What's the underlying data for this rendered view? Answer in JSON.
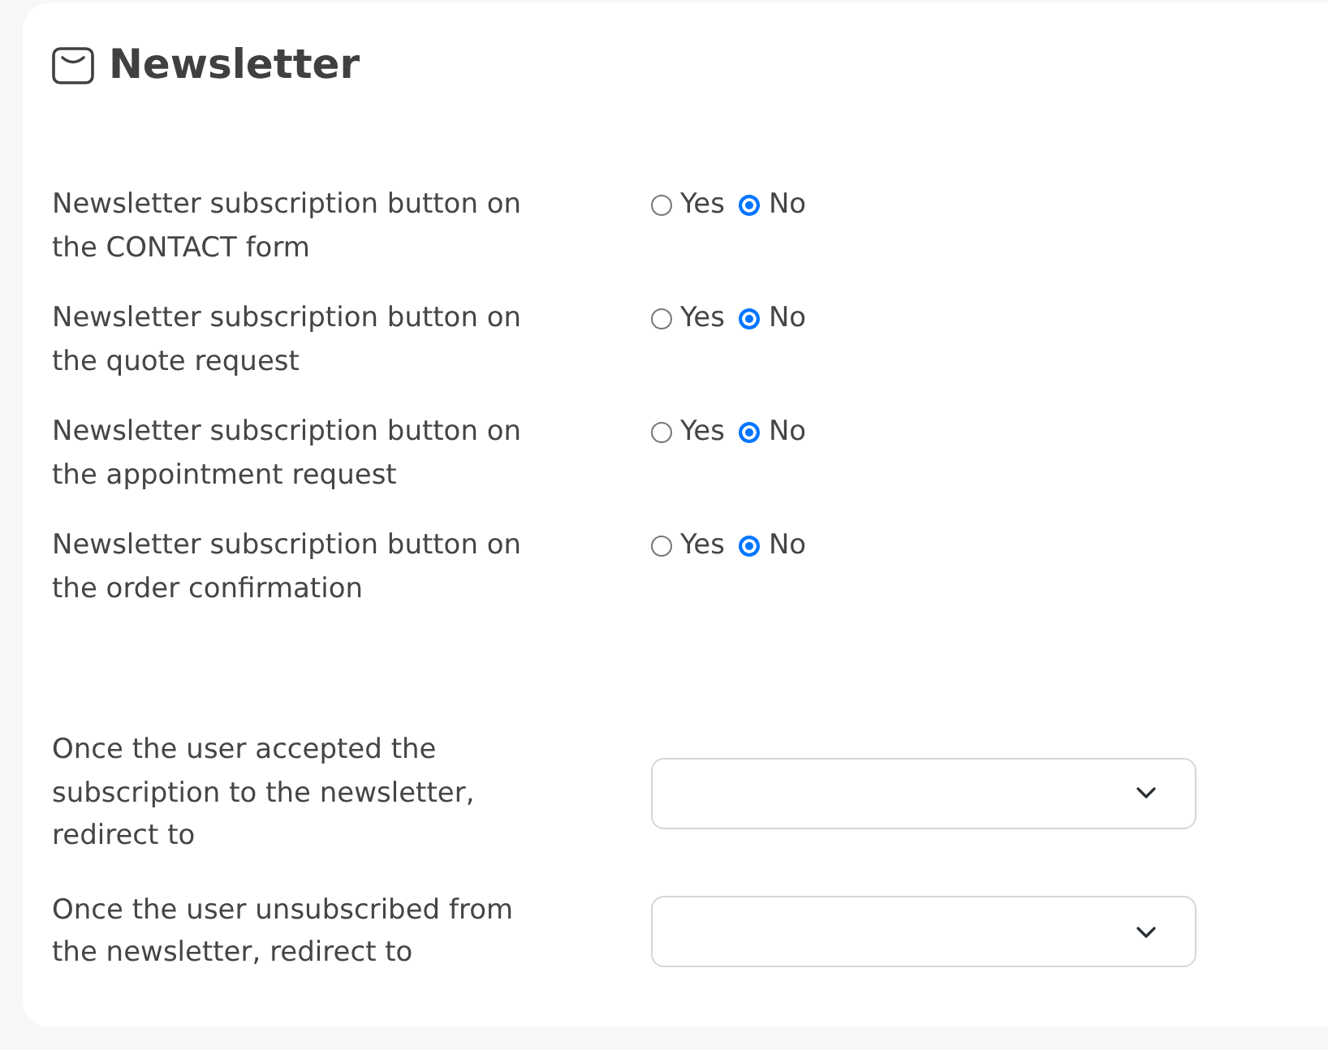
{
  "section": {
    "title": "Newsletter"
  },
  "options": [
    {
      "label": "Newsletter subscription button on the CONTACT form",
      "choices": [
        {
          "label": "Yes",
          "selected": false
        },
        {
          "label": "No",
          "selected": true
        }
      ]
    },
    {
      "label": "Newsletter subscription button on the quote request",
      "choices": [
        {
          "label": "Yes",
          "selected": false
        },
        {
          "label": "No",
          "selected": true
        }
      ]
    },
    {
      "label": "Newsletter subscription button on the appointment request",
      "choices": [
        {
          "label": "Yes",
          "selected": false
        },
        {
          "label": "No",
          "selected": true
        }
      ]
    },
    {
      "label": "Newsletter subscription button on the order confirmation",
      "choices": [
        {
          "label": "Yes",
          "selected": false
        },
        {
          "label": "No",
          "selected": true
        }
      ]
    }
  ],
  "redirects": [
    {
      "label": "Once the user accepted the subscription to the newsletter, redirect to"
    },
    {
      "label": "Once the user unsubscribed from the newsletter, redirect to"
    }
  ]
}
